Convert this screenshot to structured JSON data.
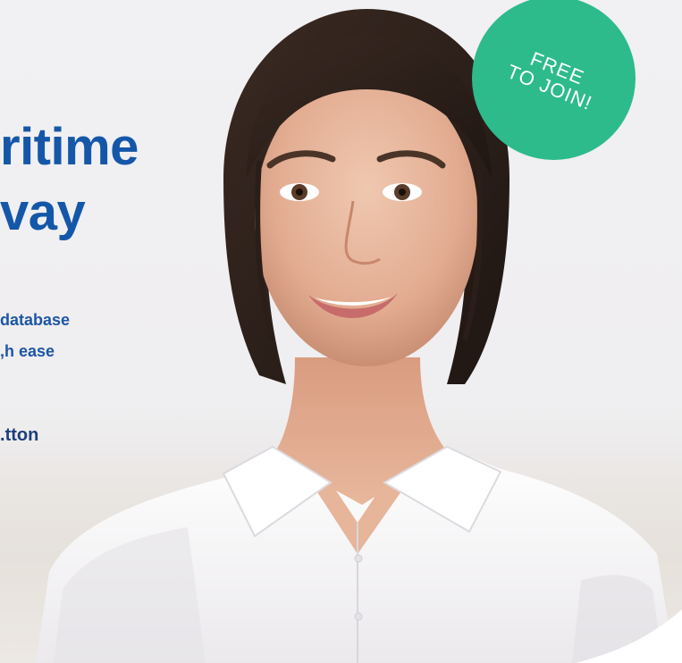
{
  "hero": {
    "headline_line1": "ritime",
    "headline_line2": "vay",
    "desc_line1": "database",
    "desc_line2": "h ease,",
    "cta_text": "tton."
  },
  "badge": {
    "line1": "FREE",
    "line2": "TO JOIN!",
    "color": "#2dbb8c"
  },
  "colors": {
    "headline": "#1457a8",
    "body_text": "#1d56a4",
    "background": "#f1f0f2"
  }
}
